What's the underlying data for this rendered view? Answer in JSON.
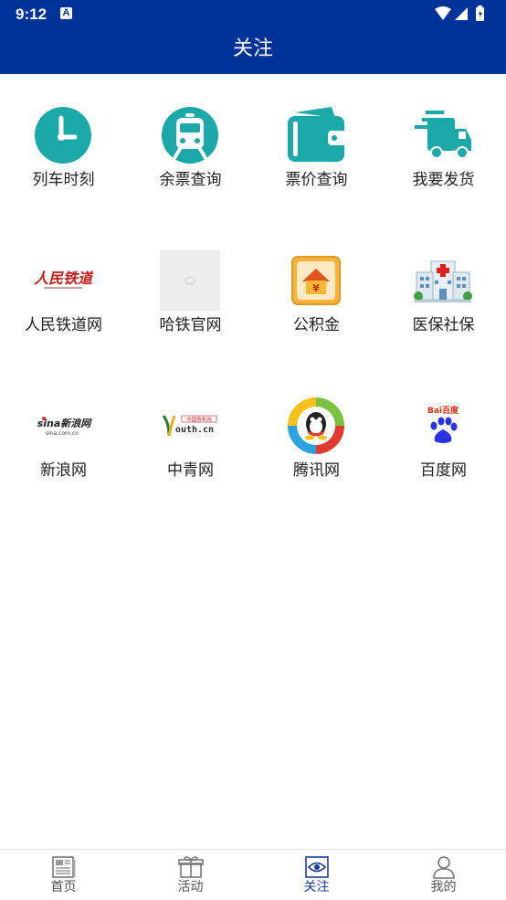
{
  "status": {
    "time": "9:12",
    "notification_glyph": "A"
  },
  "header": {
    "title": "关注"
  },
  "grid": {
    "items": [
      {
        "label": "列车时刻",
        "icon": "clock-icon"
      },
      {
        "label": "余票查询",
        "icon": "train-icon"
      },
      {
        "label": "票价查询",
        "icon": "wallet-icon"
      },
      {
        "label": "我要发货",
        "icon": "delivery-truck-icon"
      },
      {
        "label": "人民铁道网",
        "icon": "peoples-railway-logo-icon",
        "logo_text": "人民铁道"
      },
      {
        "label": "哈铁官网",
        "icon": "placeholder-image-icon"
      },
      {
        "label": "公积金",
        "icon": "housing-fund-icon",
        "logo_text": "¥"
      },
      {
        "label": "医保社保",
        "icon": "hospital-icon"
      },
      {
        "label": "新浪网",
        "icon": "sina-logo-icon",
        "logo_text": "sina新浪网",
        "logo_sub": "sina.com.cn"
      },
      {
        "label": "中青网",
        "icon": "youth-logo-icon",
        "logo_text": "outh.cn",
        "logo_badge": "中国青年网"
      },
      {
        "label": "腾讯网",
        "icon": "tencent-logo-icon"
      },
      {
        "label": "百度网",
        "icon": "baidu-logo-icon",
        "logo_text": "Bai百度"
      }
    ]
  },
  "bottom_nav": {
    "items": [
      {
        "label": "首页",
        "icon": "newspaper-icon",
        "active": false
      },
      {
        "label": "活动",
        "icon": "gift-icon",
        "active": false
      },
      {
        "label": "关注",
        "icon": "eye-icon",
        "active": true
      },
      {
        "label": "我的",
        "icon": "person-icon",
        "active": false
      }
    ]
  },
  "colors": {
    "header_bg": "#003399",
    "teal": "#1aa8a8",
    "nav_active": "#1f3c99"
  }
}
